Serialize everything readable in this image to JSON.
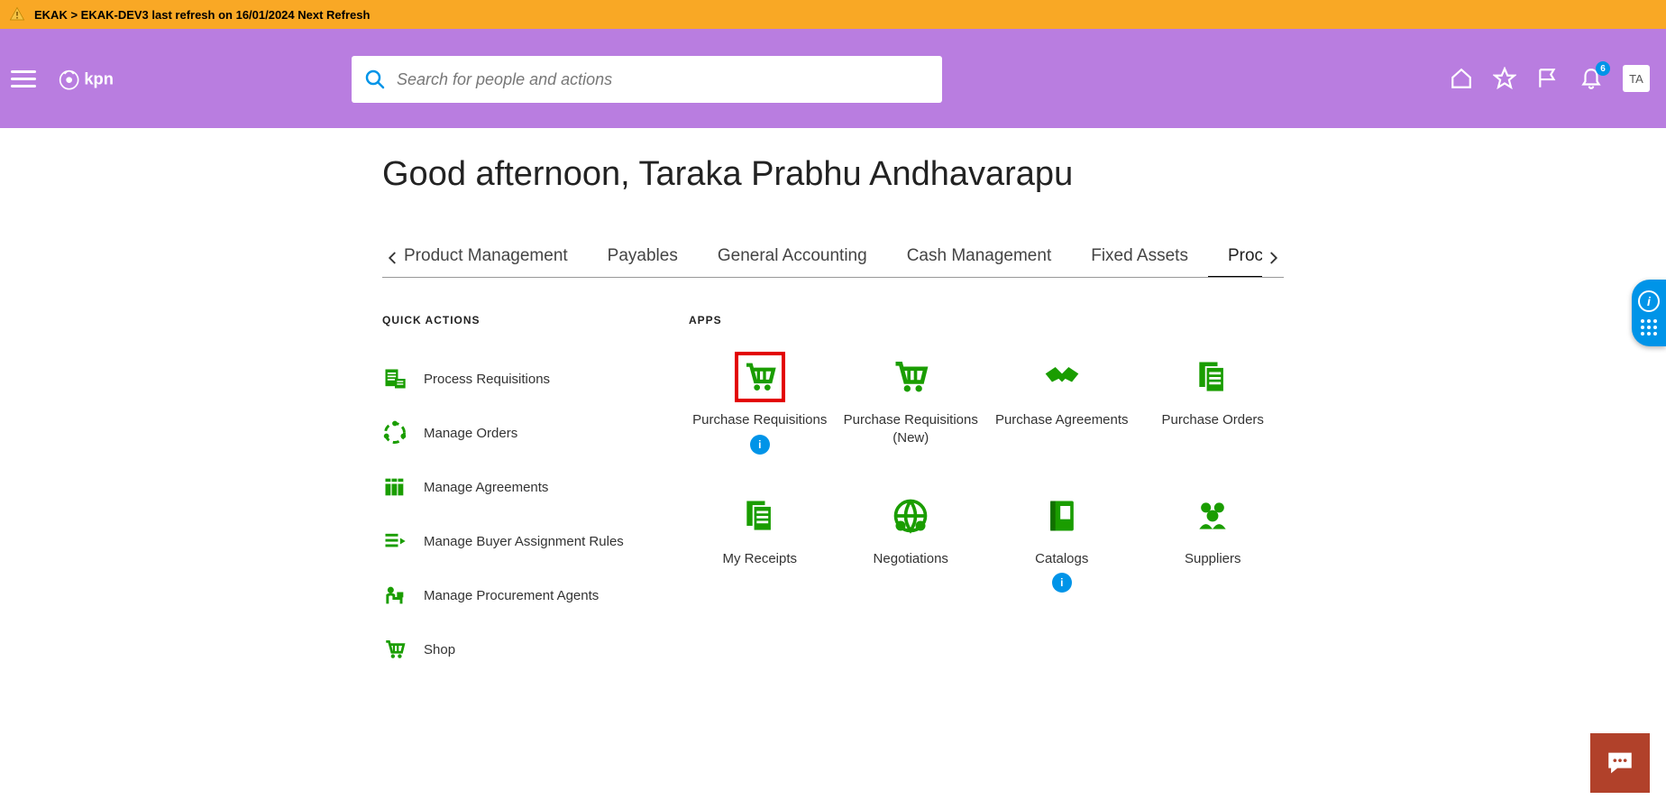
{
  "banner": {
    "text": "EKAK > EKAK-DEV3 last refresh on 16/01/2024 Next Refresh"
  },
  "header": {
    "logo_text": "kpn",
    "search_placeholder": "Search for people and actions",
    "notification_count": "6",
    "avatar_initials": "TA"
  },
  "greeting": "Good afternoon, Taraka Prabhu Andhavarapu",
  "tabs": [
    {
      "label": "Product Management",
      "active": false
    },
    {
      "label": "Payables",
      "active": false
    },
    {
      "label": "General Accounting",
      "active": false
    },
    {
      "label": "Cash Management",
      "active": false
    },
    {
      "label": "Fixed Assets",
      "active": false
    },
    {
      "label": "Procurement",
      "active": true
    }
  ],
  "section_titles": {
    "quick_actions": "QUICK ACTIONS",
    "apps": "APPS"
  },
  "quick_actions": [
    {
      "label": "Process Requisitions",
      "icon": "document-list-icon"
    },
    {
      "label": "Manage Orders",
      "icon": "cycle-icon"
    },
    {
      "label": "Manage Agreements",
      "icon": "books-icon"
    },
    {
      "label": "Manage Buyer Assignment Rules",
      "icon": "list-arrow-icon"
    },
    {
      "label": "Manage Procurement Agents",
      "icon": "person-desk-icon"
    },
    {
      "label": "Shop",
      "icon": "cart-icon"
    }
  ],
  "apps": [
    {
      "label": "Purchase Requisitions",
      "icon": "cart-icon",
      "highlighted": true,
      "info": true
    },
    {
      "label": "Purchase Requisitions (New)",
      "icon": "cart-icon",
      "highlighted": false,
      "info": false
    },
    {
      "label": "Purchase Agreements",
      "icon": "handshake-icon",
      "highlighted": false,
      "info": false
    },
    {
      "label": "Purchase Orders",
      "icon": "documents-icon",
      "highlighted": false,
      "info": false
    },
    {
      "label": "My Receipts",
      "icon": "documents-icon",
      "highlighted": false,
      "info": false
    },
    {
      "label": "Negotiations",
      "icon": "globe-people-icon",
      "highlighted": false,
      "info": false
    },
    {
      "label": "Catalogs",
      "icon": "book-icon",
      "highlighted": false,
      "info": true
    },
    {
      "label": "Suppliers",
      "icon": "people-icon",
      "highlighted": false,
      "info": false
    }
  ],
  "help_widget": {
    "symbol": "i"
  },
  "info_symbol": "i"
}
